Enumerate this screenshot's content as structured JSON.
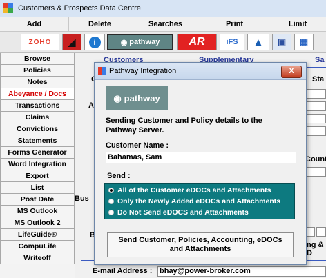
{
  "window": {
    "title": "Customers & Prospects Data Centre"
  },
  "menu": [
    "Add",
    "Delete",
    "Searches",
    "Print",
    "Limit"
  ],
  "toolbar": {
    "zoho": "ZOHO",
    "pathway": "pathway",
    "ar": "AR",
    "ifs": "iFS"
  },
  "sidebar": [
    "Browse",
    "Policies",
    "Notes",
    "Abeyance / Docs",
    "Transactions",
    "Claims",
    "Convictions",
    "Statements",
    "Forms Generator",
    "Word Integration",
    "Export",
    "List",
    "Post Date",
    "MS Outlook",
    "MS Outlook 2",
    "LifeGuide®",
    "CompuLife",
    "Writeoff"
  ],
  "tabs": {
    "customers": "Customers",
    "supplementary": "Supplementary",
    "sa": "Sa"
  },
  "background_fragments": {
    "c": "C",
    "sta": "Sta",
    "a": "A",
    "countr": "Countr",
    "bus": "Bus",
    "b": "B",
    "ng": "ng & D"
  },
  "email": {
    "label": "E-mail Address :",
    "value": "bhay@power-broker.com"
  },
  "dialog": {
    "title": "Pathway Integration",
    "close_label": "X",
    "logo_text": "pathway",
    "description_line1": "Sending Customer and Policy details to the",
    "description_line2": "Pathway Server.",
    "customer_name_label": "Customer Name :",
    "customer_name_value": "Bahamas, Sam",
    "send_label": "Send :",
    "options": [
      "All of the Customer eDOCs and Attachments",
      "Only the Newly Added eDOCs and Attachments",
      "Do Not Send eDOCS and Attachments"
    ],
    "selected_option": 0,
    "send_button_line1": "Send Customer, Policies, Accounting, eDOCs",
    "send_button_line2": "and Attachments"
  }
}
